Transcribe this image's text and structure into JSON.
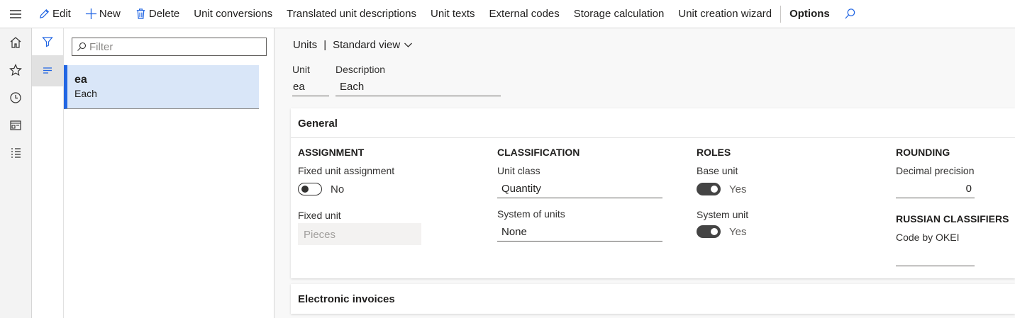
{
  "actions": {
    "edit": "Edit",
    "new": "New",
    "delete": "Delete",
    "unit_conversions": "Unit conversions",
    "translated_unit_descriptions": "Translated unit descriptions",
    "unit_texts": "Unit texts",
    "external_codes": "External codes",
    "storage_calculation": "Storage calculation",
    "unit_creation_wizard": "Unit creation wizard",
    "options": "Options"
  },
  "list": {
    "filter_placeholder": "Filter",
    "items": [
      {
        "title": "ea",
        "subtitle": "Each"
      }
    ]
  },
  "detail": {
    "breadcrumb": {
      "page": "Units",
      "view": "Standard view"
    },
    "header": {
      "unit_label": "Unit",
      "unit_value": "ea",
      "description_label": "Description",
      "description_value": "Each"
    },
    "general": {
      "title": "General",
      "assignment": {
        "heading": "ASSIGNMENT",
        "fixed_unit_assignment_label": "Fixed unit assignment",
        "fixed_unit_assignment_value": "No",
        "fixed_unit_label": "Fixed unit",
        "fixed_unit_value": "Pieces"
      },
      "classification": {
        "heading": "CLASSIFICATION",
        "unit_class_label": "Unit class",
        "unit_class_value": "Quantity",
        "system_of_units_label": "System of units",
        "system_of_units_value": "None"
      },
      "roles": {
        "heading": "ROLES",
        "base_unit_label": "Base unit",
        "base_unit_value": "Yes",
        "system_unit_label": "System unit",
        "system_unit_value": "Yes"
      },
      "rounding": {
        "heading": "ROUNDING",
        "decimal_precision_label": "Decimal precision",
        "decimal_precision_value": "0",
        "russian_heading": "RUSSIAN CLASSIFIERS",
        "code_by_okei_label": "Code by OKEI",
        "code_by_okei_value": ""
      }
    },
    "electronic_invoices": {
      "title": "Electronic invoices"
    }
  },
  "colors": {
    "accent": "#2266e3",
    "selected_row": "#d9e6f8",
    "icon_blue": "#2266e3"
  }
}
